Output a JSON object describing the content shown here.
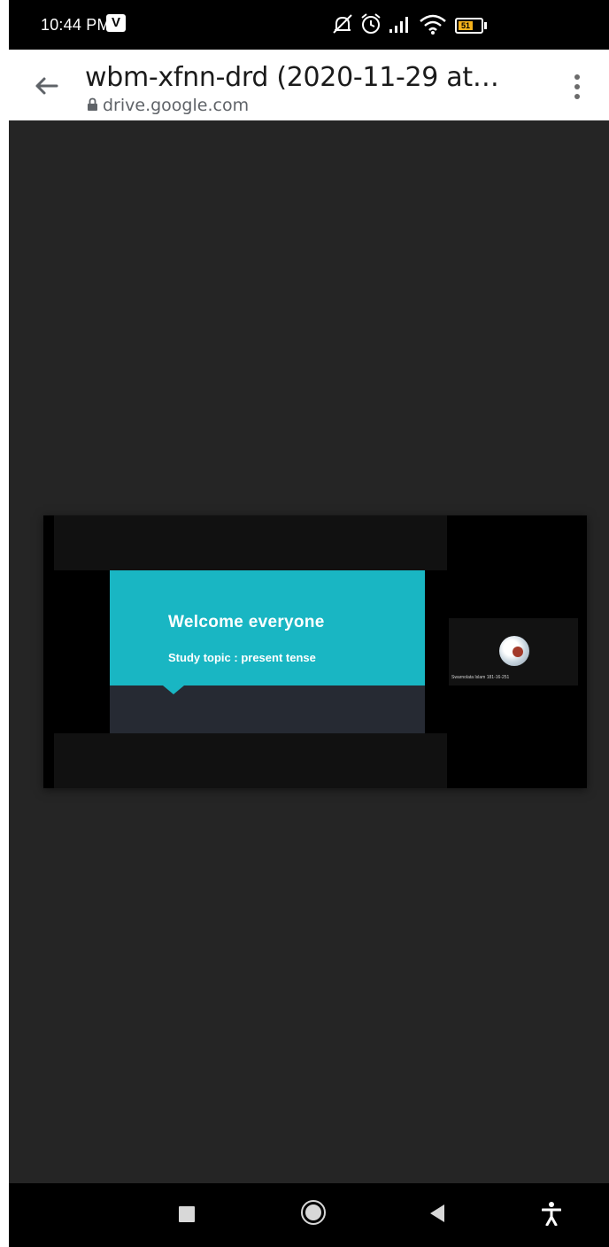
{
  "status_bar": {
    "time": "10:44 PM",
    "notification_badge": "V",
    "battery_level": "51",
    "icons": [
      "mute-icon",
      "alarm-icon",
      "signal-icon",
      "wifi-icon",
      "battery-icon"
    ]
  },
  "header": {
    "title": "wbm-xfnn-drd (2020-11-29 at…",
    "url": "drive.google.com"
  },
  "video": {
    "slide_title": "Welcome everyone",
    "slide_subtitle": "Study topic : present tense",
    "participant_name": "Swarnolata Islam 181-16-251"
  },
  "colors": {
    "slide_accent": "#19b6c3",
    "content_background": "#252525",
    "battery_fill": "#f6b21b"
  }
}
